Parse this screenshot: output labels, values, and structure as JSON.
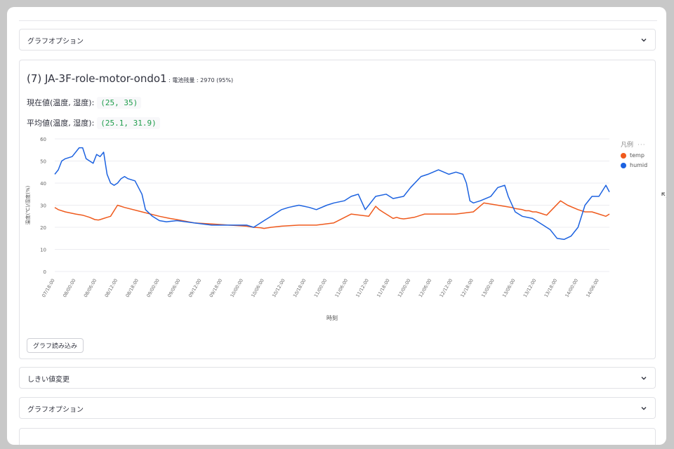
{
  "sections": {
    "graph_options_top": "グラフオプション",
    "threshold_change": "しきい値変更",
    "graph_options_bottom": "グラフオプション"
  },
  "device": {
    "title": "(7) JA-3F-role-motor-ondo1",
    "battery_label": " : 電池残量 : 2970 (95%)",
    "current_label": "現在値(温度, 湿度):",
    "current_value": "(25, 35)",
    "average_label": "平均値(温度, 湿度):",
    "average_value": "(25.1, 31.9)"
  },
  "load_button": "グラフ読み込み",
  "colors": {
    "temp": "#ef5a1d",
    "humid": "#1c62e0"
  },
  "chart_data": {
    "type": "line",
    "xlabel": "時刻",
    "ylabel": "温度(℃)/湿度(%)",
    "ylim": [
      0,
      60
    ],
    "yticks": [
      0,
      10,
      20,
      30,
      40,
      50,
      60
    ],
    "xticks": [
      "07/18:00",
      "08/00:00",
      "08/06:00",
      "08/12:00",
      "08/18:00",
      "09/00:00",
      "09/06:00",
      "09/12:00",
      "09/18:00",
      "10/00:00",
      "10/06:00",
      "10/12:00",
      "10/18:00",
      "11/00:00",
      "11/06:00",
      "11/12:00",
      "11/18:00",
      "12/00:00",
      "12/06:00",
      "12/12:00",
      "12/18:00",
      "13/00:00",
      "13/06:00",
      "13/12:00",
      "13/18:00",
      "14/00:00",
      "14/06:00"
    ],
    "x_hours_range": [
      0,
      159
    ],
    "legend_title": "凡例",
    "legend_position": "top-right",
    "grid": true,
    "series": [
      {
        "name": "temp",
        "x": [
          0,
          1,
          3,
          6,
          8,
          10,
          11.5,
          12.5,
          13,
          14,
          15,
          16,
          18,
          20,
          25,
          30,
          33,
          35,
          40,
          45,
          50,
          55,
          57,
          59,
          60,
          62,
          65,
          70,
          75,
          80,
          85,
          90,
          92,
          93,
          94,
          95,
          96,
          97,
          98,
          99,
          100,
          101,
          103,
          104,
          105,
          106,
          110,
          115,
          120,
          123,
          127,
          129,
          131,
          132,
          134,
          135,
          136,
          137,
          138,
          139,
          140,
          141,
          145,
          147,
          150,
          152,
          154,
          156,
          158,
          159
        ],
        "y": [
          29,
          28,
          27,
          26,
          25.5,
          24.5,
          23.5,
          23.3,
          23.5,
          24,
          24.5,
          25,
          30,
          29,
          27,
          25,
          24,
          23.5,
          22,
          21.5,
          21,
          20.5,
          20,
          19.8,
          19.5,
          20,
          20.5,
          21,
          21,
          22,
          26,
          25,
          29.5,
          28,
          27,
          26,
          25,
          24,
          24.5,
          24,
          23.8,
          24,
          24.5,
          25,
          25.5,
          26,
          26,
          26,
          27,
          31,
          30,
          29.5,
          29,
          28.5,
          28,
          27.5,
          27.5,
          27,
          27,
          26.5,
          26,
          25.5,
          32,
          30,
          28,
          27,
          27,
          26,
          25,
          26
        ]
      },
      {
        "name": "humid",
        "x": [
          0,
          1,
          2,
          3,
          5,
          7,
          8,
          9,
          10,
          11,
          12,
          13,
          14,
          15,
          16,
          17,
          18,
          19,
          20,
          21,
          23,
          25,
          26,
          28,
          30,
          32,
          35,
          40,
          45,
          50,
          55,
          57,
          58,
          60,
          62,
          65,
          67,
          70,
          73,
          75,
          78,
          80,
          83,
          85,
          87,
          89,
          90,
          91,
          92,
          95,
          97,
          100,
          102,
          105,
          107,
          110,
          113,
          115,
          117,
          118,
          119,
          120,
          122,
          125,
          127,
          129,
          130,
          132,
          134,
          137,
          140,
          142,
          144,
          146,
          148,
          150,
          152,
          154,
          156,
          158,
          159
        ],
        "y": [
          44,
          46,
          50,
          51,
          52,
          56,
          56,
          51,
          50,
          49,
          53,
          52,
          54,
          44,
          40,
          39,
          40,
          42,
          43,
          42,
          41,
          35,
          28,
          25,
          23,
          22.5,
          23,
          22,
          21,
          21,
          21,
          20,
          21,
          23,
          25,
          28,
          29,
          30,
          29,
          28,
          30,
          31,
          32,
          34,
          35,
          28,
          30,
          32,
          34,
          35,
          33,
          34,
          38,
          43,
          44,
          46,
          44,
          45,
          44,
          40,
          32,
          31,
          32,
          34,
          38,
          39,
          34,
          27,
          25,
          24,
          21,
          19,
          15,
          14.5,
          16,
          20,
          30,
          34,
          34,
          39,
          36
        ]
      }
    ]
  }
}
